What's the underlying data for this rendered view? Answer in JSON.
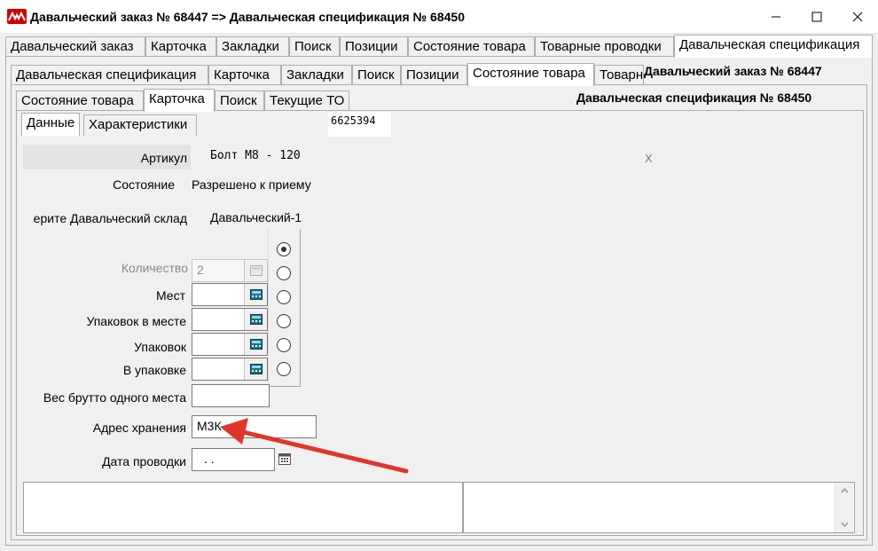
{
  "window": {
    "title": "Давальческий заказ № 68447 => Давальческая спецификация № 68450",
    "icon": "app-logo-icon"
  },
  "tabs_level1": [
    "Давальческий заказ",
    "Карточка",
    "Закладки",
    "Поиск",
    "Позиции",
    "Состояние товара",
    "Товарные проводки",
    "Давальческая спецификация"
  ],
  "tabs_level2": [
    "Давальческая спецификация",
    "Карточка",
    "Закладки",
    "Поиск",
    "Позиции",
    "Состояние товара",
    "Товарн"
  ],
  "header_order": "Давальческий заказ № 68447",
  "tabs_level3": [
    "Состояние товара",
    "Карточка",
    "Поиск",
    "Текущие ТО"
  ],
  "header_spec": "Давальческая спецификация № 68450",
  "tabs_level4": [
    "Данные",
    "Характеристики"
  ],
  "code_value": "6625394",
  "form": {
    "articul_label": "Артикул",
    "articul_value": "Болт М8  - 120",
    "articul_clear": "X",
    "state_label": "Состояние",
    "state_value": "Разрешено к приему",
    "warehouse_label": "ерите Давальческий склад",
    "warehouse_value": "Давальческий-1",
    "qty_label": "Количество",
    "qty_value": "2",
    "places_label": "Мест",
    "packs_per_place_label": "Упаковок в месте",
    "packs_label": "Упаковок",
    "in_pack_label": "В упаковке",
    "gross_label": "Вес брутто одного места",
    "address_label": "Адрес хранения",
    "address_value": "М3К",
    "date_label": "Дата проводки",
    "date_value": ". ."
  },
  "colors": {
    "arrow": "#e0352b",
    "app_icon": "#d40000"
  }
}
